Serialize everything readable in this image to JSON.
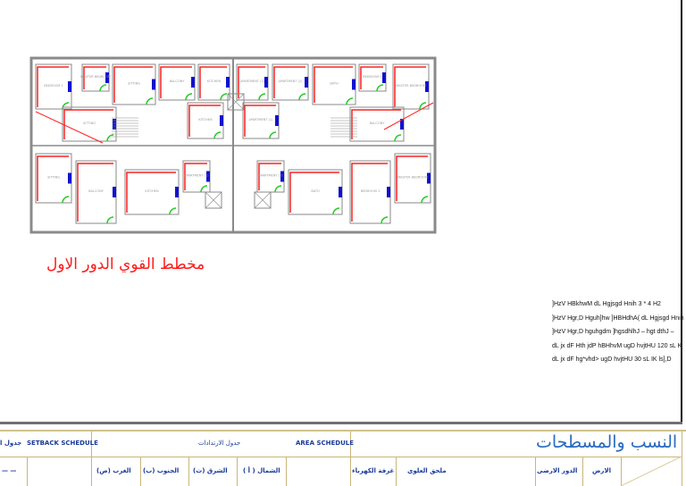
{
  "drawing": {
    "title": "مخطط القوي الدور الاول",
    "room_labels": [
      "BEDROOM 1",
      "MASTER BEDROOM",
      "SITTING",
      "BALCONY",
      "KITCHEN",
      "APARTMENT (1)",
      "APARTMENT (2)",
      "BATH"
    ]
  },
  "notes": [
    "]HzV  HBkhwM  dL  Hgjsgd  Hnih  3   *   4  H2",
    "]HzV  Hgr,D  Hguh]hw  ]HBHdhA(  dL  Hgjsgd  Hnih",
    "]HzV  Hgr,D  hguhgdm  ]hgsdhlhJ  –   hgt dthJ  –",
    "dL  jx dF  Hth jdP  hBHhvM  ugD  hvjtHU    120    sL  K",
    "dL  jx dF  hg*vhd>  ugD  hvjtHU    30    sL  IK  ls],D"
  ],
  "schedule": {
    "setback_title_ar": "جدول ا",
    "setback_title_en": "SETBACK SCHEDULE",
    "setbacks_ar": "جدول الارتدادات",
    "area_title_en": "AREA SCHEDULE",
    "area_title_ar": "النسب والمسطحات",
    "dash": "— —",
    "west": "الغرب (ص)",
    "south": "الجنوب (ب)",
    "east": "الشرق (ث)",
    "north": "الشمال ( أ )",
    "electric_room": "غرفة الكهرباء",
    "roof_annex": "ملحق العلوي",
    "ground_floor": "الدور الارضي",
    "land": "الارض"
  },
  "colors": {
    "wall": "#8a8a8a",
    "wiring": "#ff2020",
    "fixture": "#22cc22",
    "panel": "#1010d0",
    "title": "#ff1a1a",
    "table": "#c9b67a",
    "table_text": "#1a3a9a"
  }
}
